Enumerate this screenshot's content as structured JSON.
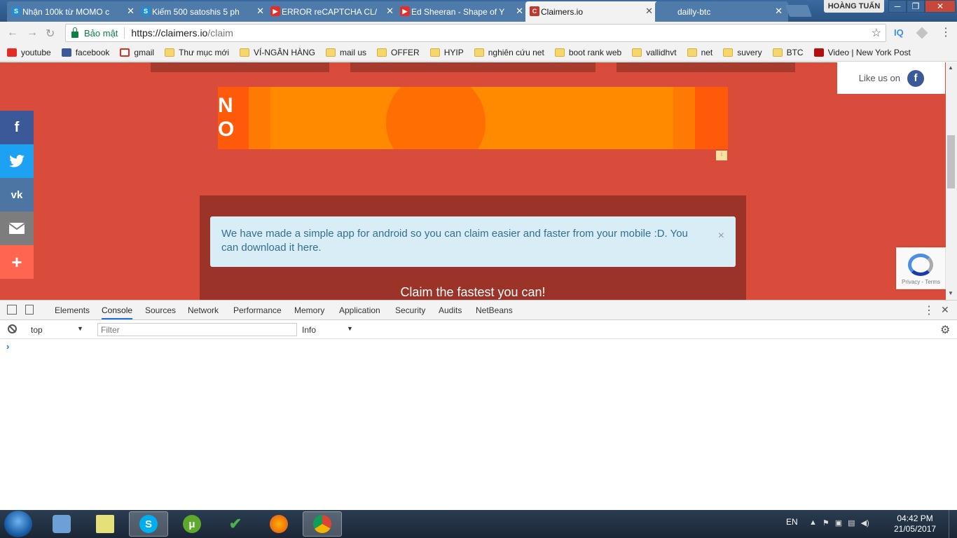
{
  "browser": {
    "tabs": [
      {
        "title": "Nhận 100k từ MOMO c",
        "icon": "skype-icon",
        "active": false
      },
      {
        "title": "Kiếm 500 satoshis 5 ph",
        "icon": "skype-icon",
        "active": false
      },
      {
        "title": "ERROR reCAPTCHA CL/",
        "icon": "youtube-icon",
        "active": false
      },
      {
        "title": "Ed Sheeran - Shape of Y",
        "icon": "youtube-icon",
        "active": false
      },
      {
        "title": "Claimers.io",
        "icon": "claimers-icon",
        "active": true
      },
      {
        "title": "dailly-btc",
        "icon": "",
        "active": false
      }
    ],
    "user": "HOÀNG TUẤN",
    "address": {
      "secure_label": "Bảo mật",
      "url_host": "https://claimers.io",
      "url_path": "/claim"
    },
    "extension1": "IQ",
    "bookmarks": [
      {
        "label": "youtube",
        "icon": "youtube-icon"
      },
      {
        "label": "facebook",
        "icon": "facebook-icon"
      },
      {
        "label": "gmail",
        "icon": "gmail-icon"
      },
      {
        "label": "Thư mục mới",
        "icon": "folder-icon"
      },
      {
        "label": "VÍ-NGÂN HÀNG",
        "icon": "folder-icon"
      },
      {
        "label": "mail us",
        "icon": "folder-icon"
      },
      {
        "label": "OFFER",
        "icon": "folder-icon"
      },
      {
        "label": "HYIP",
        "icon": "folder-icon"
      },
      {
        "label": "nghiên cứu net",
        "icon": "folder-icon"
      },
      {
        "label": "boot rank web",
        "icon": "folder-icon"
      },
      {
        "label": "vallidhvt",
        "icon": "folder-icon"
      },
      {
        "label": "net",
        "icon": "folder-icon"
      },
      {
        "label": "suvery",
        "icon": "folder-icon"
      },
      {
        "label": "BTC",
        "icon": "folder-icon"
      },
      {
        "label": "Video | New York Post",
        "icon": "nypost-icon"
      }
    ]
  },
  "page": {
    "banner_letters": "N\nO",
    "like_label": "Like us on",
    "alert_text": "We have made a simple app for android so you can claim easier and faster from your mobile :D. You can download it here.",
    "alert_close": "×",
    "claim_title": "Claim the fastest you can!",
    "recaptcha_footer": "Privacy - Terms",
    "social_buttons": [
      "facebook-icon",
      "twitter-icon",
      "vk-icon",
      "email-icon",
      "plus-icon"
    ],
    "colors": {
      "page_bg": "#d94c3b",
      "panel": "#9c3328",
      "alert_bg": "#d9edf7",
      "alert_text": "#31708f",
      "banner": "#ff8a00"
    }
  },
  "devtools": {
    "tabs": [
      "Elements",
      "Console",
      "Sources",
      "Network",
      "Performance",
      "Memory",
      "Application",
      "Security",
      "Audits",
      "NetBeans"
    ],
    "active_tab": "Console",
    "context": "top",
    "filter_placeholder": "Filter",
    "level": "Info",
    "prompt": "›"
  },
  "taskbar": {
    "apps": [
      "virtualbox-icon",
      "sticky-notes-icon",
      "skype-icon",
      "utorrent-icon",
      "checkmark-icon",
      "firefox-icon",
      "chrome-icon"
    ],
    "lang": "EN",
    "time": "04:42 PM",
    "date": "21/05/2017"
  }
}
